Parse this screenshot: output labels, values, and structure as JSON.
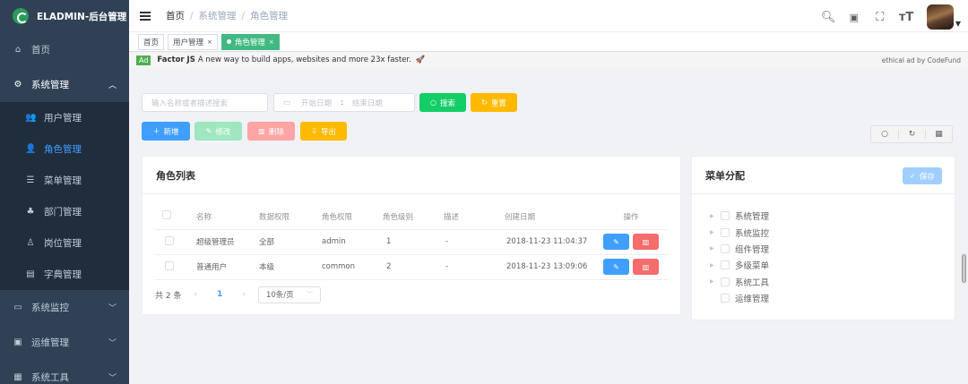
{
  "app": {
    "title": "ELADMIN-后台管理"
  },
  "sidebar": {
    "items": [
      {
        "label": "首页",
        "icon": "dashboard-icon"
      },
      {
        "label": "系统管理",
        "icon": "gear-icon",
        "expanded": true,
        "children": [
          {
            "label": "用户管理",
            "icon": "users-icon"
          },
          {
            "label": "角色管理",
            "icon": "role-icon",
            "active": true
          },
          {
            "label": "菜单管理",
            "icon": "menu-list-icon"
          },
          {
            "label": "部门管理",
            "icon": "org-icon"
          },
          {
            "label": "岗位管理",
            "icon": "position-icon"
          },
          {
            "label": "字典管理",
            "icon": "dictionary-icon"
          }
        ]
      },
      {
        "label": "系统监控",
        "icon": "monitor-icon"
      },
      {
        "label": "运维管理",
        "icon": "ops-icon"
      },
      {
        "label": "系统工具",
        "icon": "tools-icon"
      }
    ]
  },
  "breadcrumb": [
    "首页",
    "系统管理",
    "角色管理"
  ],
  "navbar_icons": [
    "search-icon",
    "github-icon",
    "fullscreen-icon",
    "font-size-icon"
  ],
  "tags": [
    {
      "label": "首页"
    },
    {
      "label": "用户管理"
    },
    {
      "label": "角色管理",
      "active": true
    }
  ],
  "ad": {
    "badge": "Ad",
    "brand": "Factor JS",
    "text": "A new way to build apps, websites and more 23x faster.",
    "right": "ethical ad by CodeFund"
  },
  "toolbar": {
    "search_placeholder": "输入名称或者描述搜索",
    "date_start": "开始日期",
    "date_sep": ":",
    "date_end": "结束日期",
    "search_btn": "搜索",
    "reset_btn": "重置",
    "add_btn": "新增",
    "edit_btn": "修改",
    "delete_btn": "删除",
    "export_btn": "导出"
  },
  "role_list": {
    "title": "角色列表",
    "columns": [
      "名称",
      "数据权限",
      "角色权限",
      "角色级别",
      "描述",
      "创建日期",
      "操作"
    ],
    "rows": [
      {
        "name": "超级管理员",
        "data_scope": "全部",
        "permission": "admin",
        "level": "1",
        "desc": "-",
        "created": "2018-11-23 11:04:37"
      },
      {
        "name": "普通用户",
        "data_scope": "本级",
        "permission": "common",
        "level": "2",
        "desc": "-",
        "created": "2018-11-23 13:09:06"
      }
    ],
    "pagination": {
      "total": "共 2 条",
      "page": "1",
      "size": "10条/页"
    }
  },
  "menu_assign": {
    "title": "菜单分配",
    "save": "保存",
    "tree": [
      "系统管理",
      "系统监控",
      "组件管理",
      "多级菜单",
      "系统工具",
      "运维管理"
    ]
  },
  "colors": {
    "sidebar": "#304156",
    "active": "#409eff",
    "success": "#13ce66",
    "warning": "#ffba00",
    "danger": "#ff4949",
    "tag_active": "#42b983"
  }
}
